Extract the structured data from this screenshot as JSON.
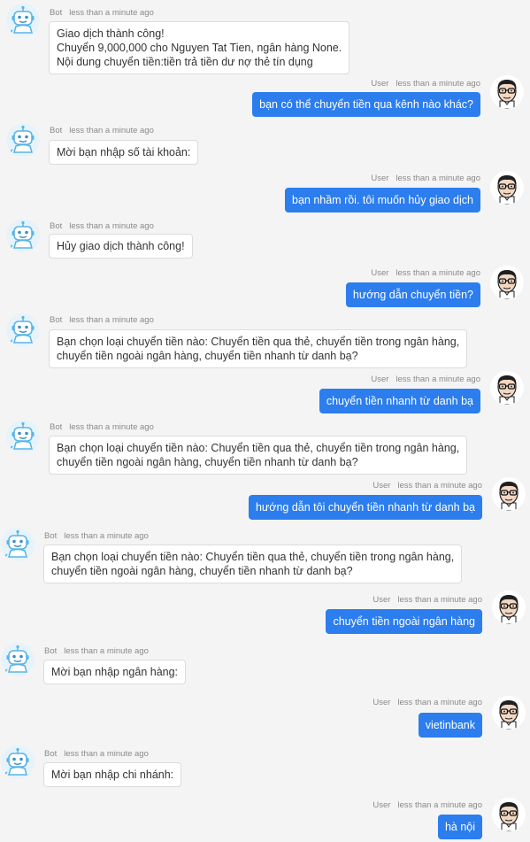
{
  "bot_avatar_icon": "robot-face-icon",
  "user_avatar_icon": "man-with-glasses-icon",
  "colors": {
    "page_background": "#f4f4f4",
    "user_bubble": "#2c7dee",
    "bot_bubble": "#ffffff",
    "meta_text": "#8a8a8a"
  },
  "messages": [
    {
      "sender": "Bot",
      "time": "less than a minute ago",
      "text": "Giao dịch thành công!\nChuyển 9,000,000 cho Nguyen Tat Tien, ngân hàng None.\nNội dung chuyển tiền:tiền trả tiền dư nợ thẻ tín dụng"
    },
    {
      "sender": "User",
      "time": "less than a minute ago",
      "text": "bạn có thể chuyển tiền qua kênh nào khác?"
    },
    {
      "sender": "Bot",
      "time": "less than a minute ago",
      "text": "Mời bạn nhập số tài khoản:"
    },
    {
      "sender": "User",
      "time": "less than a minute ago",
      "text": "bạn nhầm rồi. tôi muốn hủy giao dịch"
    },
    {
      "sender": "Bot",
      "time": "less than a minute ago",
      "text": "Hủy giao dịch thành công!"
    },
    {
      "sender": "User",
      "time": "less than a minute ago",
      "text": "hướng dẫn chuyển tiền?"
    },
    {
      "sender": "Bot",
      "time": "less than a minute ago",
      "text": "Bạn chọn loại chuyển tiền nào: Chuyển tiền qua thẻ, chuyển tiền trong ngân hàng,\nchuyển tiền ngoài ngân hàng, chuyển tiền nhanh từ danh bạ?"
    },
    {
      "sender": "User",
      "time": "less than a minute ago",
      "text": "chuyển tiền nhanh từ danh bạ"
    },
    {
      "sender": "Bot",
      "time": "less than a minute ago",
      "text": "Bạn chọn loại chuyển tiền nào: Chuyển tiền qua thẻ, chuyển tiền trong ngân hàng,\nchuyển tiền ngoài ngân hàng, chuyển tiền nhanh từ danh bạ?"
    },
    {
      "sender": "User",
      "time": "less than a minute ago",
      "text": "hướng dẫn tôi chuyển tiền nhanh từ danh bạ"
    },
    {
      "sender": "Bot",
      "time": "less than a minute ago",
      "text": "Bạn chọn loại chuyển tiền nào: Chuyển tiền qua thẻ, chuyển tiền trong ngân hàng,\nchuyển tiền ngoài ngân hàng, chuyển tiền nhanh từ danh bạ?"
    },
    {
      "sender": "User",
      "time": "less than a minute ago",
      "text": "chuyển tiền ngoài ngân hàng"
    },
    {
      "sender": "Bot",
      "time": "less than a minute ago",
      "text": "Mời bạn nhập ngân hàng:"
    },
    {
      "sender": "User",
      "time": "less than a minute ago",
      "text": "vietinbank"
    },
    {
      "sender": "Bot",
      "time": "less than a minute ago",
      "text": "Mời bạn nhập chi nhánh:"
    },
    {
      "sender": "User",
      "time": "less than a minute ago",
      "text": "hà nội"
    }
  ]
}
